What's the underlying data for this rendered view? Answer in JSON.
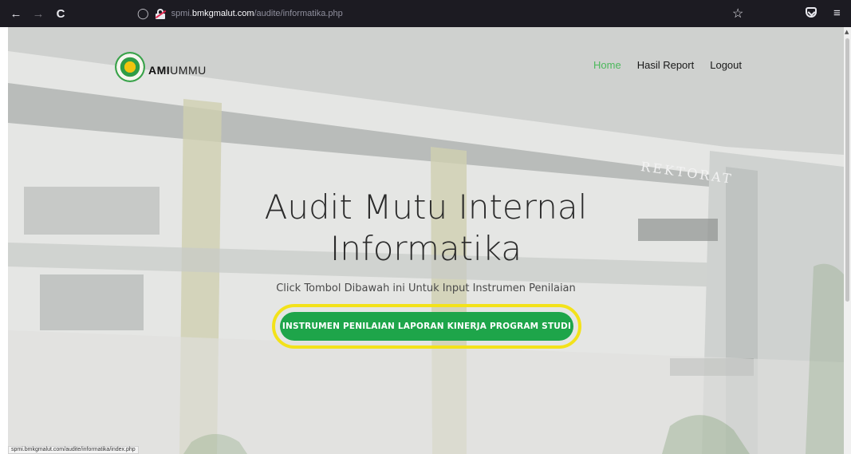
{
  "browser": {
    "back_icon": "←",
    "forward_icon": "→",
    "reload_icon": "C",
    "url_prefix": "spmi.",
    "url_host": "bmkgmalut.com",
    "url_path": "/audite/informatika.php",
    "star_icon": "☆",
    "menu_icon": "≡"
  },
  "navbar": {
    "brand_bold": "AMI",
    "brand_rest": "UMMU",
    "links": [
      "Home",
      "Hasil Report",
      "Logout"
    ],
    "active": "Home",
    "accent_color": "#4cb85c"
  },
  "hero": {
    "building_sign": "REKTORAT",
    "title_line1": "Audit Mutu Internal",
    "title_line2": "Informatika",
    "subtitle": "Click Tombol Dibawah ini Untuk Input Instrumen Penilaian",
    "button_label": "INSTRUMEN PENILAIAN LAPORAN KINERJA PROGRAM STUDI",
    "button_color": "#1ea54a",
    "highlight_color": "#f3e21a"
  },
  "status_bar": {
    "url": "spmi.bmkgmalut.com/audite/informatika/index.php"
  }
}
